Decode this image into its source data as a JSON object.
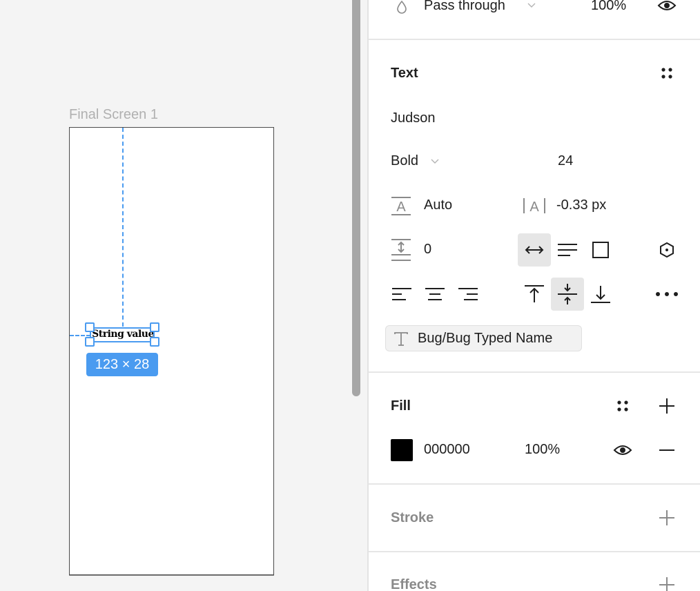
{
  "canvas": {
    "frame_label": "Final Screen 1",
    "selected_text": "String value",
    "size_badge": "123 × 28",
    "selection_color": "#4a9bf0"
  },
  "layer": {
    "blend_mode": "Pass through",
    "opacity": "100%",
    "visibility_icon": "eye-icon"
  },
  "text_section": {
    "title": "Text",
    "font_family": "Judson",
    "font_weight": "Bold",
    "font_size": "24",
    "line_height": "Auto",
    "letter_spacing": "-0.33 px",
    "paragraph_spacing": "0",
    "resizing": [
      "auto-width",
      "auto-height",
      "fixed-size"
    ],
    "resizing_active": "auto-width",
    "horizontal_align": [
      "left",
      "center",
      "right"
    ],
    "vertical_align": [
      "top",
      "middle",
      "bottom"
    ],
    "vertical_align_active": "middle",
    "text_style": "Bug/Bug Typed Name"
  },
  "fill_section": {
    "title": "Fill",
    "color_hex": "000000",
    "opacity": "100%",
    "swatch_color": "#000000"
  },
  "stroke_section": {
    "title": "Stroke"
  },
  "effects_section": {
    "title": "Effects"
  }
}
